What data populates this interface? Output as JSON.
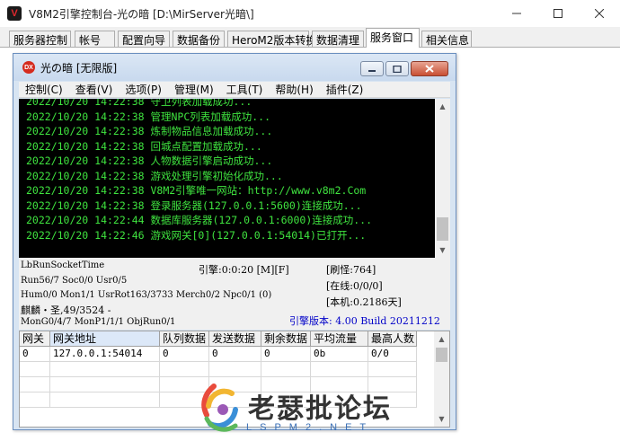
{
  "outer_window": {
    "logo_glyph": "V",
    "title": "V8M2引擎控制台-光の暗 [D:\\MirServer光暗\\]"
  },
  "tabs": [
    {
      "label": "服务器控制"
    },
    {
      "label": "帐号"
    },
    {
      "label": "配置向导"
    },
    {
      "label": "数据备份"
    },
    {
      "label": "HeroM2版本转换"
    },
    {
      "label": "数据清理"
    },
    {
      "label": "服务窗口",
      "active": true
    },
    {
      "label": "相关信息"
    }
  ],
  "inner_window": {
    "icon_text": "DX",
    "title": "光の暗 [无限版]",
    "menu": [
      "控制(C)",
      "查看(V)",
      "选项(P)",
      "管理(M)",
      "工具(T)",
      "帮助(H)",
      "插件(Z)"
    ]
  },
  "console": {
    "text_color": "#3fe33f",
    "lines": [
      "2022/10/20 14:22:38 守卫列表加载成功...",
      "2022/10/20 14:22:38 管理NPC列表加载成功...",
      "2022/10/20 14:22:38 炼制物品信息加载成功...",
      "2022/10/20 14:22:38 回城点配置加载成功...",
      "2022/10/20 14:22:38 人物数据引擎启动成功...",
      "2022/10/20 14:22:38 游戏处理引擎初始化成功...",
      "2022/10/20 14:22:38 V8M2引擎唯一网站：http://www.v8m2.Com",
      "2022/10/20 14:22:38 登录服务器(127.0.0.1:5600)连接成功...",
      "2022/10/20 14:22:44 数据库服务器(127.0.0.1:6000)连接成功...",
      "2022/10/20 14:22:46 游戏网关[0](127.0.0.1:54014)已打开..."
    ]
  },
  "status": {
    "run_socket": "LbRunSocketTime",
    "engine_time": "引擎:0:0:20 [M][F]",
    "refresh_monsters": "[刷怪:764]",
    "run_counts": "Run56/7 Soc0/0 Usr0/5",
    "online": "[在线:0/0/0]",
    "hum_line": "Hum0/0 Mon1/1 UsrRot163/3733 Merch0/2 Npc0/1 (0)",
    "local": "[本机:0.2186天]",
    "kirin": "麒麟・圣,49/3524 -",
    "mon_line": "MonG0/4/7 MonP1/1/1 ObjRun0/1",
    "engine_version": "引擎版本: 4.00 Build 20211212"
  },
  "gateway_table": {
    "columns": [
      "网关",
      "网关地址",
      "队列数据",
      "发送数据",
      "剩余数据",
      "平均流量",
      "最高人数"
    ],
    "rows": [
      [
        "0",
        "127.0.0.1:54014",
        "0",
        "0",
        "0",
        "0b",
        "0/0"
      ]
    ]
  },
  "watermark": {
    "title": "老瑟批论坛",
    "subtitle": "LSPM2.NET"
  }
}
